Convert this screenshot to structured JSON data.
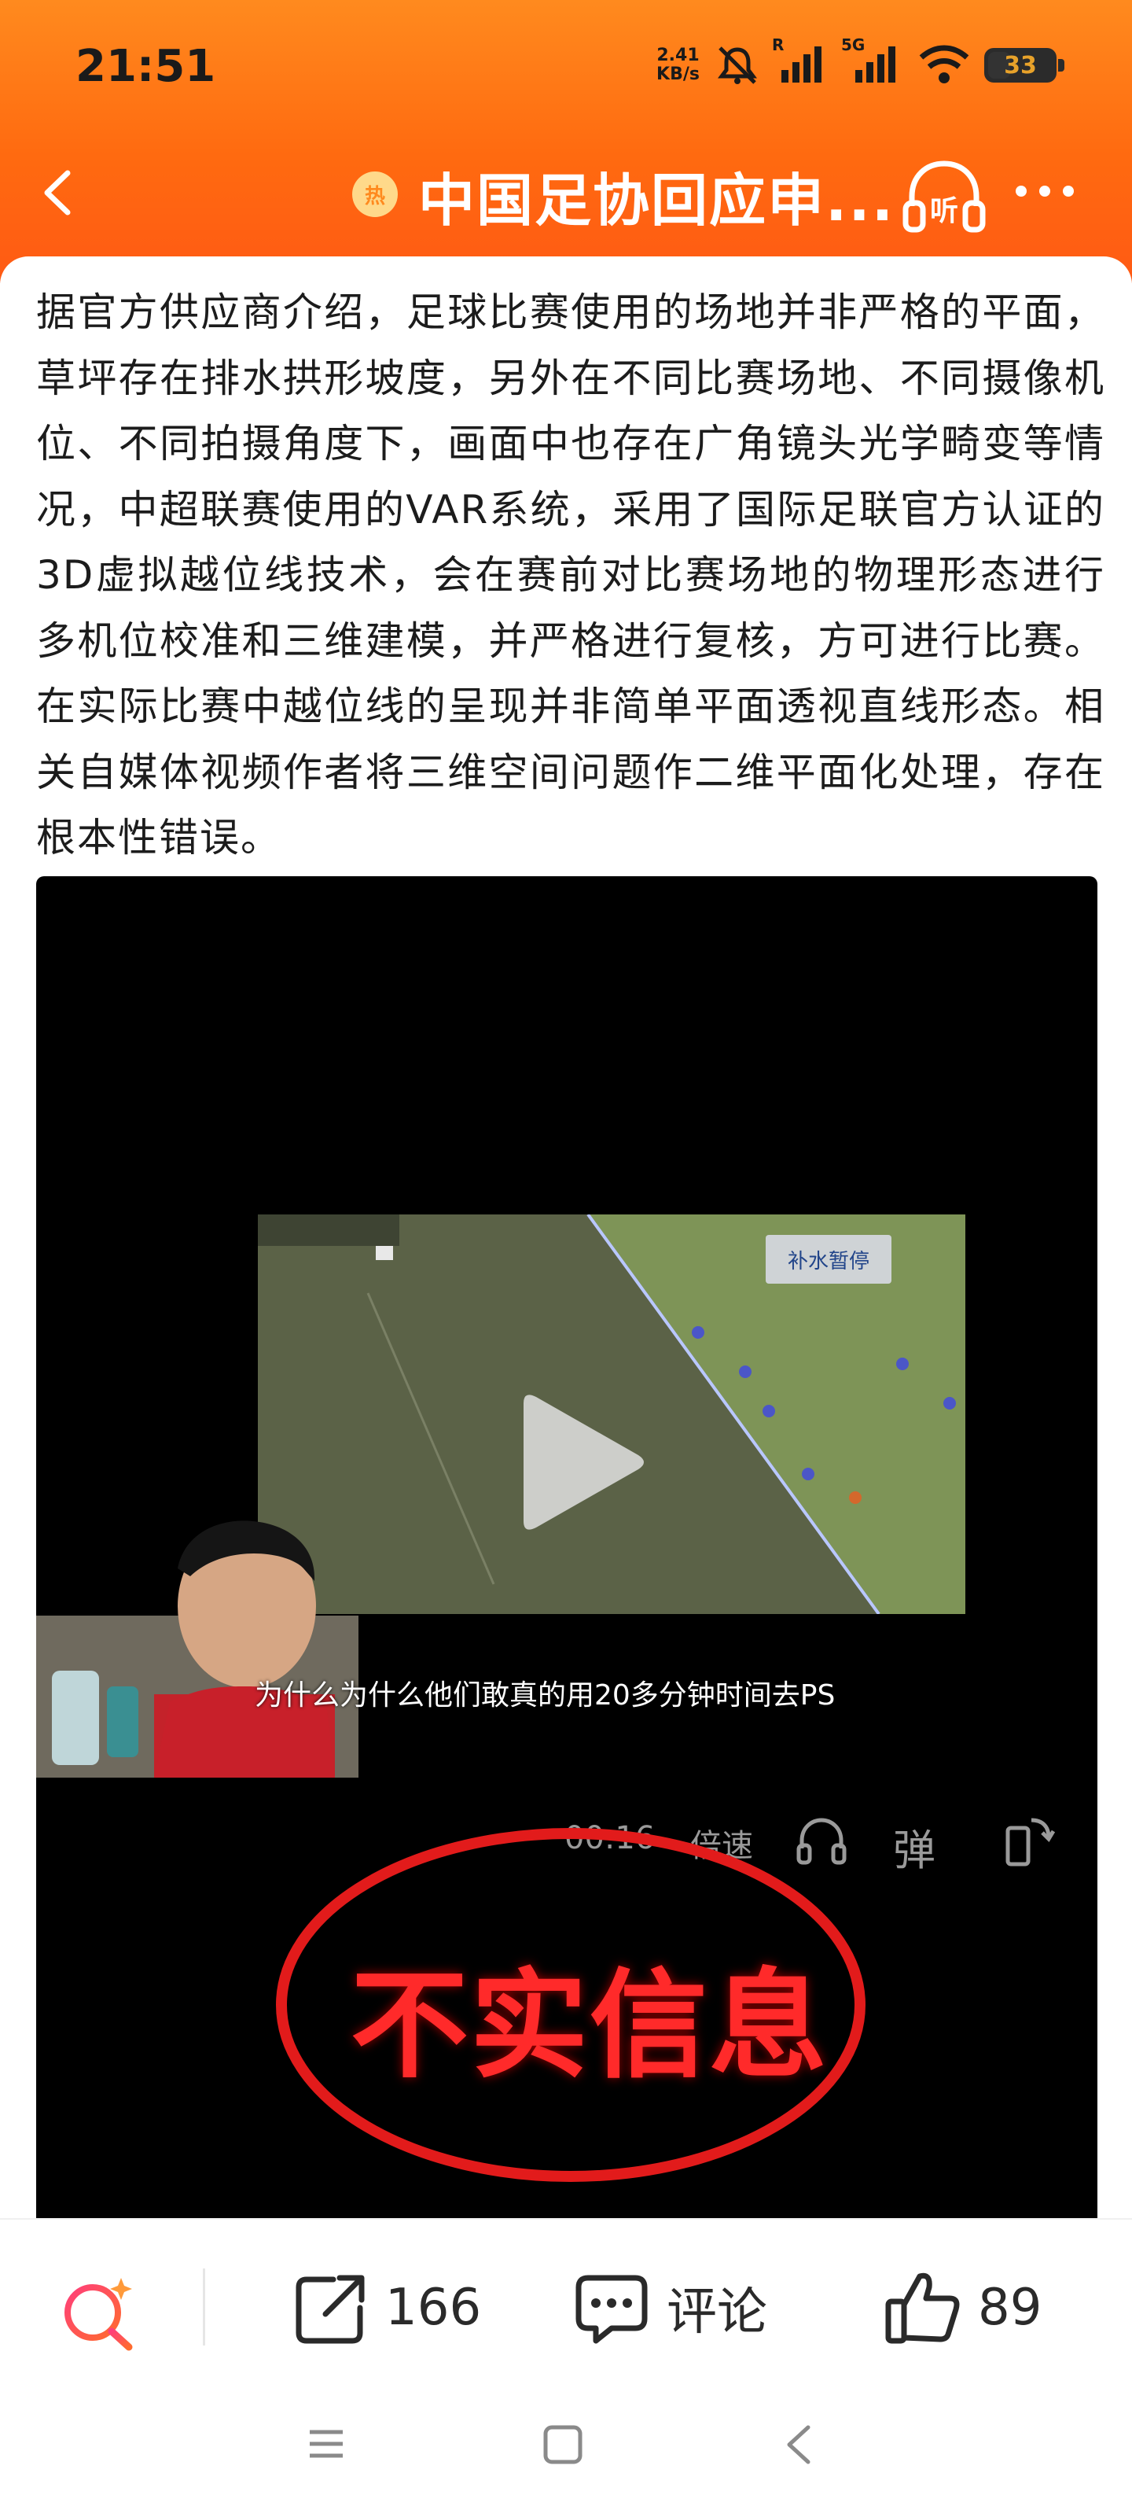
{
  "status_bar": {
    "time": "21:51",
    "net_speed_value": "2.41",
    "net_speed_unit": "KB/s",
    "signal_tag_1": "R",
    "signal_tag_2": "5G",
    "battery": "33"
  },
  "nav": {
    "hot_badge": "热",
    "title": "中国足协回应申...",
    "listen_label": "听"
  },
  "article": {
    "body": "据官方供应商介绍，足球比赛使用的场地并非严格的平面，草坪存在排水拱形坡度，另外在不同比赛场地、不同摄像机位、不同拍摄角度下，画面中也存在广角镜头光学畸变等情况，中超联赛使用的VAR系统，采用了国际足联官方认证的3D虚拟越位线技术，会在赛前对比赛场地的物理形态进行多机位校准和三维建模，并严格进行复核，方可进行比赛。在实际比赛中越位线的呈现并非简单平面透视直线形态。相关自媒体视频作者将三维空间问题作二维平面化处理，存在根本性错误。"
  },
  "video": {
    "clip_banner": "补水暂停",
    "subtitle": "为什么为什么他们敢真的用20多分钟时间去PS",
    "time": "00:16",
    "speed_label": "倍速",
    "danmu_label": "弹",
    "stamp_text": "不实信息"
  },
  "actions": {
    "share_count": "166",
    "comment_label": "评论",
    "like_count": "89"
  },
  "colors": {
    "brand_orange": "#ff6a10",
    "stamp_red": "#ff2a2a"
  }
}
